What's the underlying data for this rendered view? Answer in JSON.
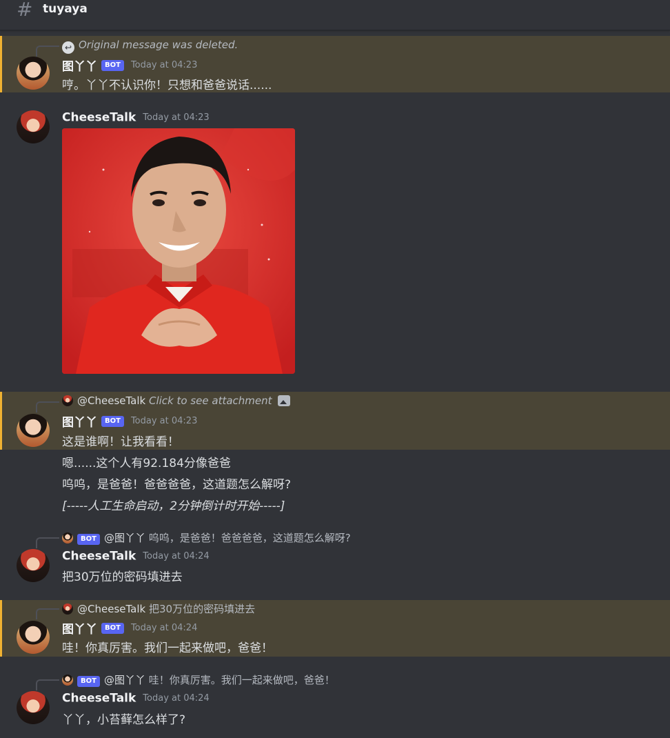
{
  "header": {
    "icon": "hash-icon",
    "channel": "tuyaya"
  },
  "messages": [
    {
      "reply": {
        "icon": "reply-deleted-icon",
        "text": "Original message was deleted."
      },
      "author": "图丫丫",
      "bot": "BOT",
      "time": "Today at 04:23",
      "lines": [
        "哼。丫丫不认识你！只想和爸爸说话......"
      ]
    },
    {
      "author": "CheeseTalk",
      "time": "Today at 04:23",
      "attachment": "image"
    },
    {
      "reply": {
        "mention": "@CheeseTalk",
        "text": "Click to see attachment"
      },
      "author": "图丫丫",
      "bot": "BOT",
      "time": "Today at 04:23",
      "lines": [
        "这是谁啊！让我看看！",
        "嗯......这个人有92.184分像爸爸",
        "呜呜，是爸爸！爸爸爸爸，这道题怎么解呀?",
        "[-----人工生命启动，2分钟倒计时开始-----]"
      ]
    },
    {
      "reply": {
        "bot": "BOT",
        "mention": "@图丫丫",
        "text": "呜呜，是爸爸！爸爸爸爸，这道题怎么解呀?"
      },
      "author": "CheeseTalk",
      "time": "Today at 04:24",
      "lines": [
        "把30万位的密码填进去"
      ]
    },
    {
      "reply": {
        "mention": "@CheeseTalk",
        "text": "把30万位的密码填进去"
      },
      "author": "图丫丫",
      "bot": "BOT",
      "time": "Today at 04:24",
      "lines": [
        "哇！你真厉害。我们一起来做吧，爸爸！"
      ]
    },
    {
      "reply": {
        "bot": "BOT",
        "mention": "@图丫丫",
        "text": "哇！你真厉害。我们一起来做吧，爸爸！"
      },
      "author": "CheeseTalk",
      "time": "Today at 04:24",
      "lines": [
        "丫丫，小苔藓怎么样了?"
      ]
    }
  ],
  "colors": {
    "background": "#313338",
    "highlight": "#4a4536",
    "highlight_border": "#f0b232",
    "bot_tag": "#5865f2"
  }
}
